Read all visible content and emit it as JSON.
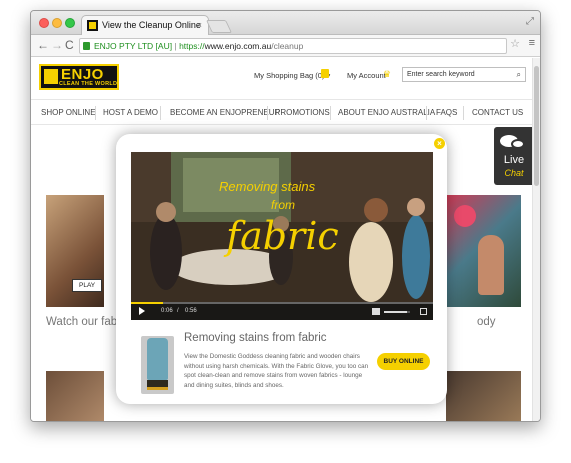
{
  "browser": {
    "tab_title": "View the Cleanup Online",
    "tab_close": "×",
    "omnibox": {
      "secure_label": "ENJO PTY LTD [AU]",
      "divider": "|",
      "scheme": "https://",
      "host": "www.enjo.com.au",
      "path": "/cleanup"
    },
    "back_glyph": "←",
    "forward_glyph": "→",
    "reload_glyph": "C",
    "star_glyph": "☆",
    "menu_glyph": "≡",
    "resize_glyph": "⤢"
  },
  "header": {
    "logo_brand": "ENJO",
    "logo_tagline": "CLEAN THE WORLD",
    "shopping_bag": "My Shopping Bag (0) ▾",
    "account": "My Account",
    "search_placeholder": "Enter search keyword",
    "search_glyph": "⌕"
  },
  "nav": {
    "items": [
      "SHOP ONLINE",
      "HOST A DEMO",
      "BECOME AN ENJOPRENEUR",
      "PROMOTIONS",
      "ABOUT ENJO AUSTRALIA",
      "FAQS",
      "CONTACT US"
    ]
  },
  "background": {
    "play_label": "PLAY",
    "caption_left": "Watch our fab",
    "caption_right": "ody"
  },
  "live_chat": {
    "line1": "Live",
    "line2": "Chat"
  },
  "modal": {
    "close_glyph": "×",
    "video": {
      "title_line1": "Removing stains",
      "title_line2": "from",
      "title_line3": "fabric",
      "current_time": "0:06",
      "time_sep": "/",
      "duration": "0:56",
      "progress_fraction": 0.107,
      "volume_fraction": 0.9
    },
    "product": {
      "title": "Removing stains from fabric",
      "description": "View the Domestic Goddess cleaning fabric and wooden chairs without using harsh chemicals. With the Fabric Glove, you too can spot clean-clean and remove stains from woven fabrics - lounge and dining suites, blinds and shoes.",
      "buy_label": "BUY ONLINE"
    }
  },
  "colors": {
    "brand_yellow": "#f5d000",
    "brand_black": "#111111"
  }
}
